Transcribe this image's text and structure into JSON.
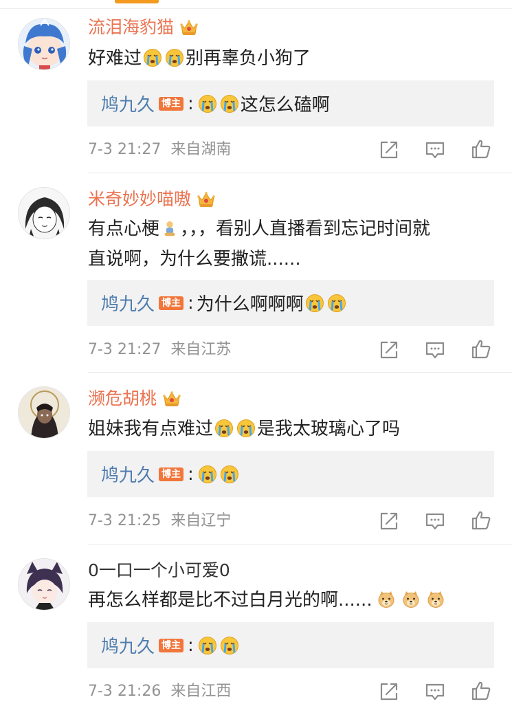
{
  "comments": [
    {
      "username": "流泪海豹猫",
      "vip": true,
      "text_before": "好难过",
      "text_emojis": [
        "crying-emoji",
        "crying-emoji"
      ],
      "text_after": "别再辜负小狗了",
      "reply": {
        "name": "鸠九久",
        "badge": "博主",
        "colon": ":",
        "emojis": [
          "crying-emoji",
          "crying-emoji"
        ],
        "text": "这怎么磕啊"
      },
      "time": "7-3 21:27",
      "location": "来自湖南"
    },
    {
      "username": "米奇妙妙喵嗷",
      "vip": true,
      "text_line1_before": "有点心梗",
      "text_line1_emoji": "sitting-figure-emoji",
      "text_line1_after": "，，，看别人直播看到忘记时间就",
      "text_line2": "直说啊，为什么要撒谎......",
      "reply": {
        "name": "鸠九久",
        "badge": "博主",
        "colon": ":",
        "text": "为什么啊啊啊",
        "emojis": [
          "crying-emoji",
          "crying-emoji"
        ]
      },
      "time": "7-3 21:27",
      "location": "来自江苏"
    },
    {
      "username": "濒危胡桃",
      "vip": true,
      "text_before": "姐妹我有点难过",
      "text_emojis": [
        "crying-emoji",
        "crying-emoji"
      ],
      "text_after": "是我太玻璃心了吗",
      "reply": {
        "name": "鸠九久",
        "badge": "博主",
        "colon": ":",
        "emojis": [
          "crying-emoji",
          "crying-emoji"
        ]
      },
      "time": "7-3 21:25",
      "location": "来自辽宁"
    },
    {
      "username": "0一口一个小可爱0",
      "vip": false,
      "text_before": "再怎么样都是比不过白月光的啊......",
      "text_emojis": [
        "doge-emoji",
        "doge-emoji",
        "doge-emoji"
      ],
      "reply": {
        "name": "鸠九久",
        "badge": "博主",
        "colon": ":",
        "emojis": [
          "crying-emoji",
          "crying-emoji"
        ]
      },
      "time": "7-3 21:26",
      "location": "来自江西"
    }
  ],
  "actions": [
    "share-icon",
    "comment-icon",
    "like-icon"
  ],
  "colors": {
    "vip_username": "#eb7350",
    "reply_name": "#507daf",
    "badge": "#f1763a",
    "meta": "#939393",
    "reply_bg": "#f2f2f2",
    "tab_indicator": "#f39a1f"
  }
}
